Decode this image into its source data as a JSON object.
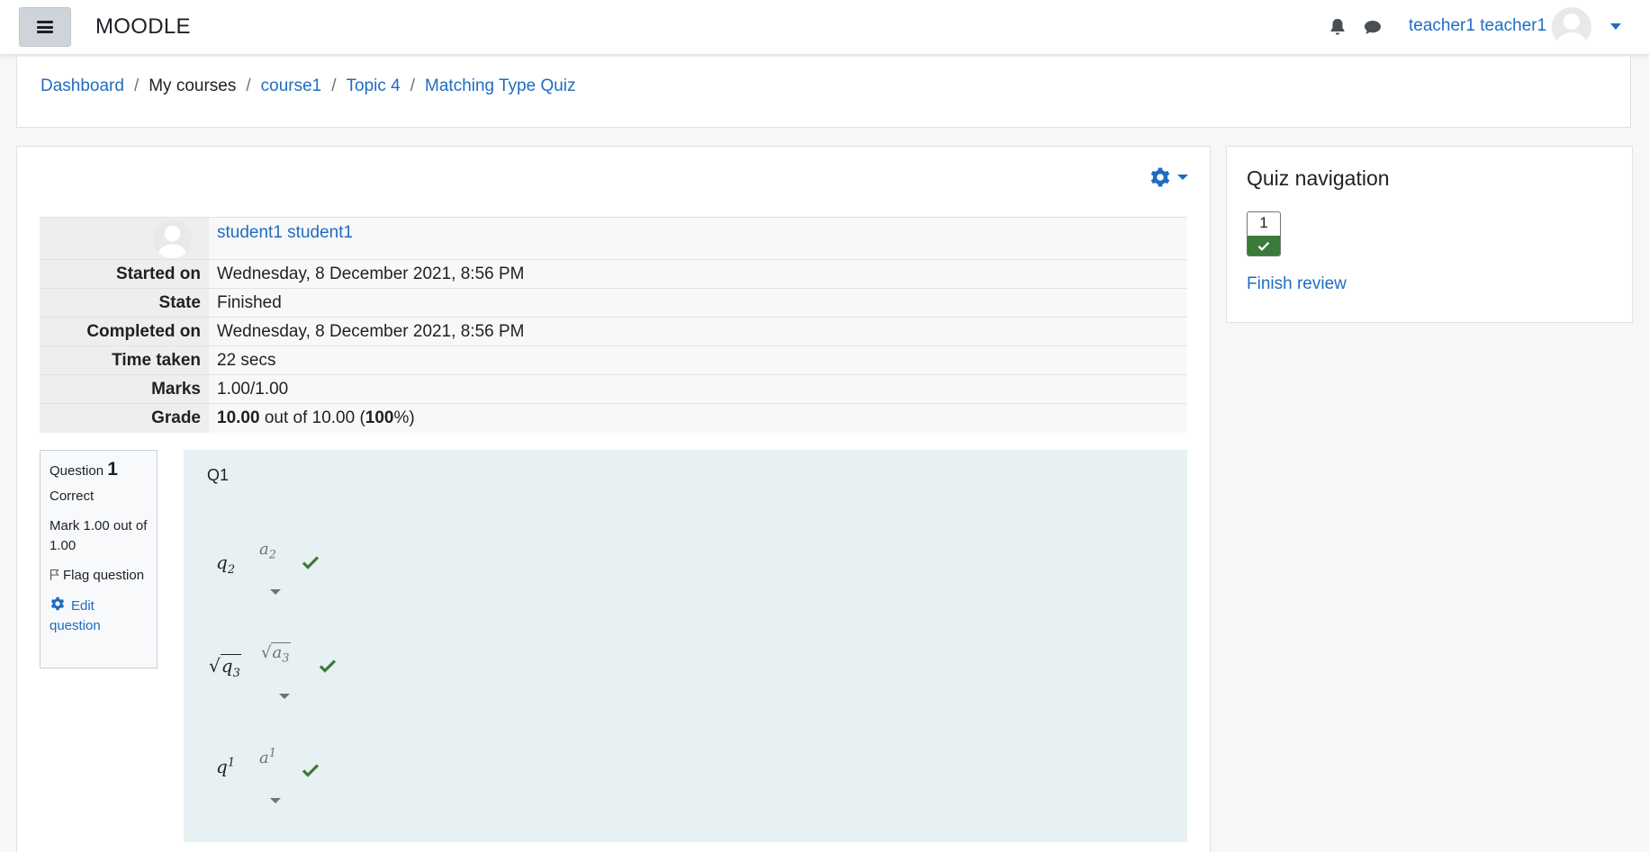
{
  "navbar": {
    "brand": "MOODLE",
    "user_name": "teacher1 teacher1"
  },
  "breadcrumb": [
    {
      "label": "Dashboard"
    },
    {
      "label": "My courses"
    },
    {
      "label": "course1"
    },
    {
      "label": "Topic 4"
    },
    {
      "label": "Matching Type Quiz"
    }
  ],
  "summary": {
    "student_name": "student1 student1",
    "rows": [
      {
        "label": "Started on",
        "value": "Wednesday, 8 December 2021, 8:56 PM"
      },
      {
        "label": "State",
        "value": "Finished"
      },
      {
        "label": "Completed on",
        "value": "Wednesday, 8 December 2021, 8:56 PM"
      },
      {
        "label": "Time taken",
        "value": "22 secs"
      },
      {
        "label": "Marks",
        "value": "1.00/1.00"
      }
    ],
    "grade": {
      "label": "Grade",
      "score": "10.00",
      "out_of_text": " out of 10.00 (",
      "percent": "100",
      "suffix": "%)"
    }
  },
  "question_info": {
    "label": "Question",
    "number": "1",
    "status": "Correct",
    "mark": "Mark 1.00 out of 1.00",
    "flag": "Flag question",
    "edit": "Edit question"
  },
  "question": {
    "text": "Q1",
    "items": [
      {
        "stem_base": "q",
        "stem_sub": "2",
        "answer_base": "a",
        "answer_sub": "2",
        "correct": true
      },
      {
        "stem_base": "q",
        "stem_sub": "3",
        "answer_base": "a",
        "answer_sub": "3",
        "correct": true
      },
      {
        "stem_base": "q",
        "stem_sup": "1",
        "answer_base": "a",
        "answer_sup": "1",
        "correct": true
      }
    ]
  },
  "quiz_nav": {
    "title": "Quiz navigation",
    "buttons": [
      {
        "number": "1",
        "state": "correct"
      }
    ],
    "finish_label": "Finish review"
  },
  "colors": {
    "link": "#1f6cc1",
    "correct": "#3b7a3a",
    "question_bg": "#e7f0f3"
  }
}
